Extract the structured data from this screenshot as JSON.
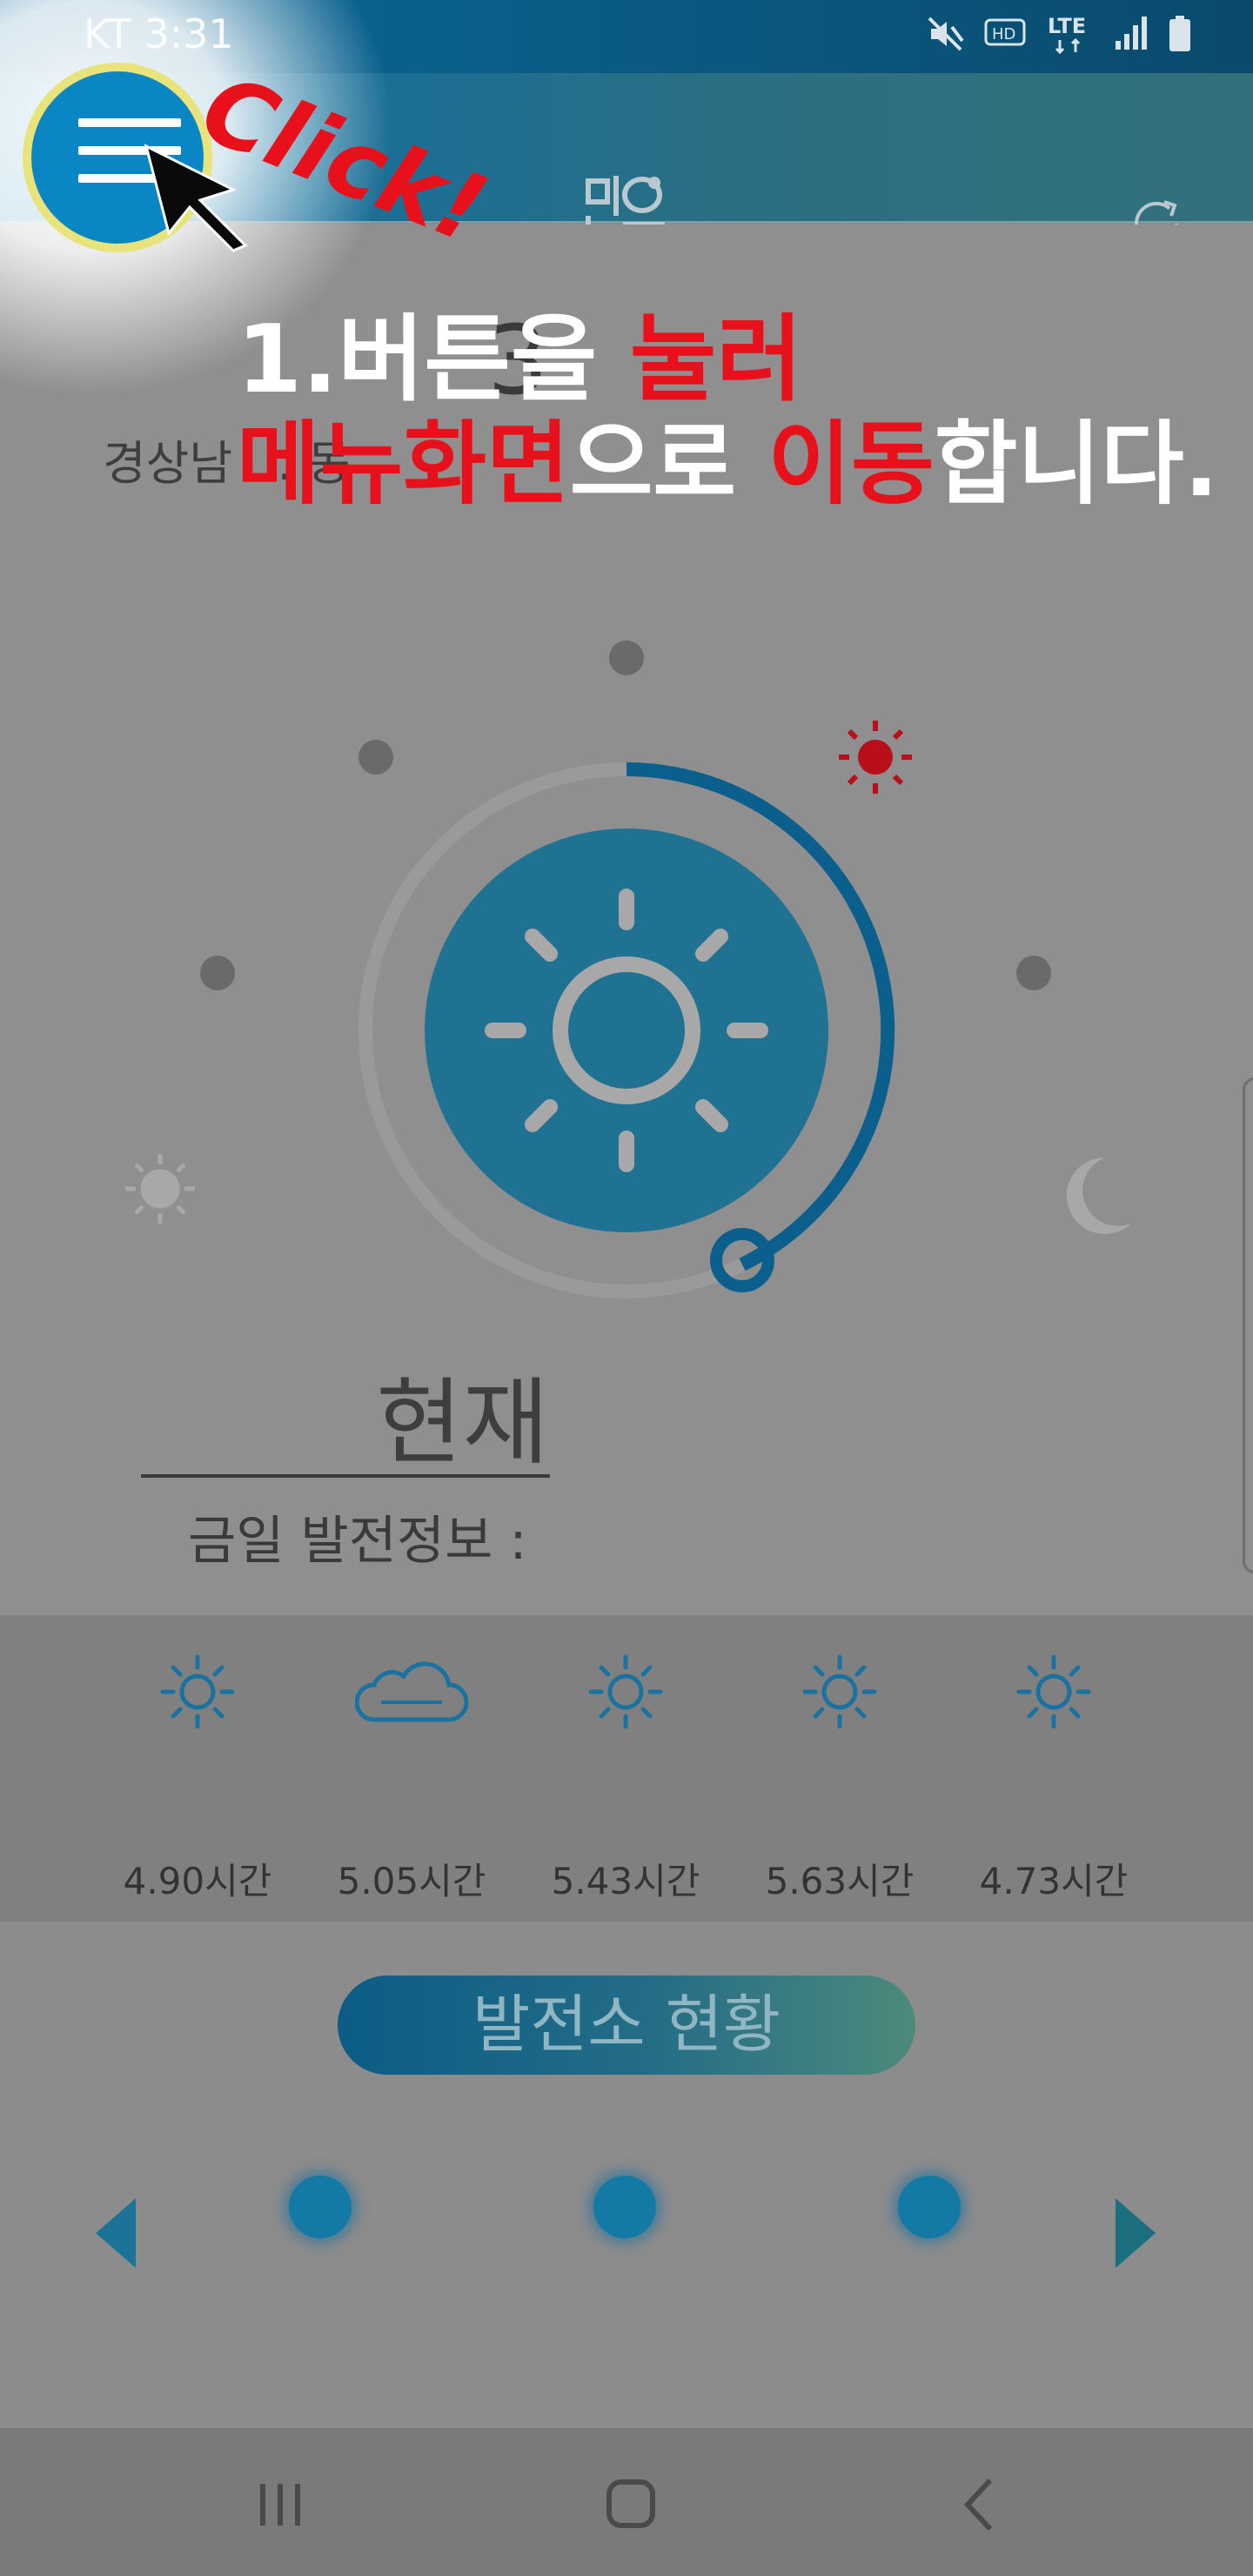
{
  "status_bar": {
    "time": "KT 3:31",
    "network": "LTE",
    "icons": [
      "mute-icon",
      "hd-voice-icon",
      "lte-icon",
      "signal-icon",
      "battery-icon"
    ]
  },
  "app_bar": {
    "logo": "맑음",
    "menu_icon": "hamburger-menu-icon",
    "refresh_icon": "refresh-icon"
  },
  "main": {
    "location": "경상남 ... 동",
    "location_digit": "3",
    "now_label": "현재",
    "today_info": "금일 발전정보 :"
  },
  "forecast": [
    {
      "icon": "sun-icon",
      "hours": "4.90시간"
    },
    {
      "icon": "cloud-icon",
      "hours": "5.05시간"
    },
    {
      "icon": "sun-icon",
      "hours": "5.43시간"
    },
    {
      "icon": "sun-icon",
      "hours": "5.63시간"
    },
    {
      "icon": "sun-icon",
      "hours": "4.73시간"
    }
  ],
  "plant": {
    "button_label": "발전소 현황"
  },
  "nav": {
    "recent": "recent-apps-icon",
    "home": "home-icon",
    "back": "back-icon"
  },
  "tutorial": {
    "click": "Click!",
    "step_number": "1.",
    "line1_part1": "버튼을 ",
    "line1_part2": "눌러",
    "line2_part1": "메뉴화면",
    "line2_part2": "으로 ",
    "line2_part3": "이동",
    "line2_part4": "합니다.",
    "highlight_color": "#e8101a"
  },
  "colors": {
    "primary": "#0b6a9c",
    "accent_blue": "#137aa6",
    "highlight_ring": "#e8e37a"
  }
}
